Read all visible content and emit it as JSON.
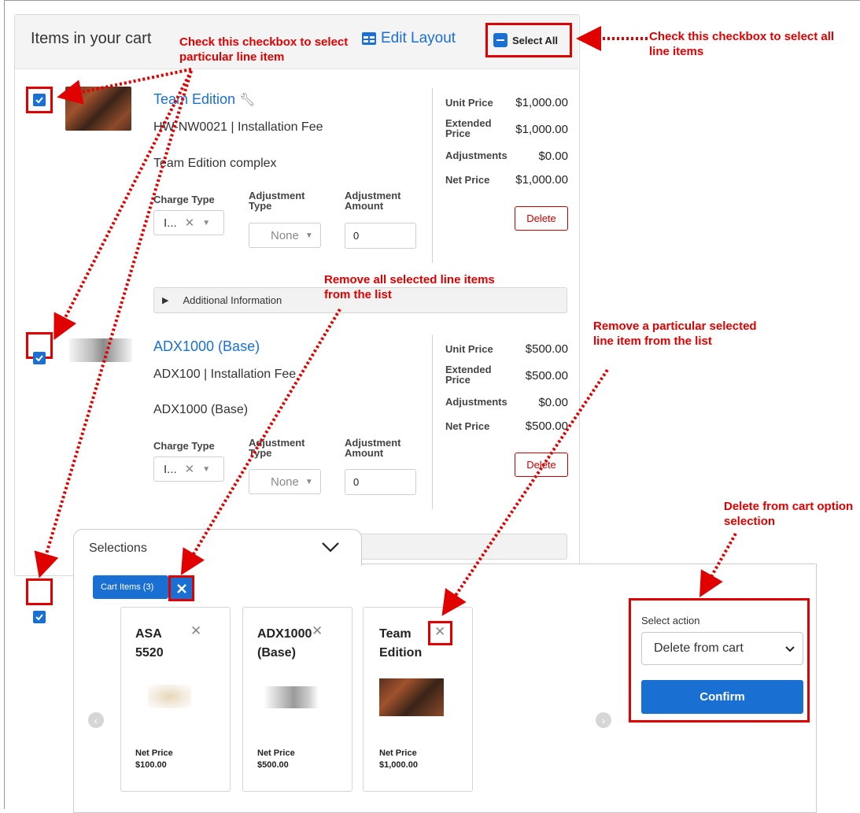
{
  "cart": {
    "title": "Items in your cart",
    "edit_layout": "Edit Layout",
    "select_all": "Select All"
  },
  "line_items": [
    {
      "name": "Team Edition",
      "meta": "HW-NW0021 | Installation Fee",
      "description": "Team Edition complex",
      "charge_type_label": "Charge Type",
      "charge_type_value": "I...",
      "adjustment_type_label": "Adjustment Type",
      "adjustment_type_value": "None",
      "adjustment_amount_label": "Adjustment Amount",
      "adjustment_amount_value": "0",
      "unit_price_label": "Unit Price",
      "unit_price": "$1,000.00",
      "extended_price_label": "Extended Price",
      "extended_price": "$1,000.00",
      "adjustments_label": "Adjustments",
      "adjustments": "$0.00",
      "net_price_label": "Net Price",
      "net_price": "$1,000.00",
      "delete_label": "Delete",
      "additional_info": "Additional Information"
    },
    {
      "name": "ADX1000 (Base)",
      "meta": "ADX100 | Installation Fee",
      "description": "ADX1000 (Base)",
      "charge_type_label": "Charge Type",
      "charge_type_value": "I...",
      "adjustment_type_label": "Adjustment Type",
      "adjustment_type_value": "None",
      "adjustment_amount_label": "Adjustment Amount",
      "adjustment_amount_value": "0",
      "unit_price_label": "Unit Price",
      "unit_price": "$500.00",
      "extended_price_label": "Extended Price",
      "extended_price": "$500.00",
      "adjustments_label": "Adjustments",
      "adjustments": "$0.00",
      "net_price_label": "Net Price",
      "net_price": "$500.00",
      "delete_label": "Delete"
    }
  ],
  "selections": {
    "title": "Selections",
    "chip": "Cart Items (3)",
    "cards": [
      {
        "title": "ASA 5520",
        "np_label": "Net Price",
        "np_value": "$100.00"
      },
      {
        "title": "ADX1000 (Base)",
        "np_label": "Net Price",
        "np_value": "$500.00"
      },
      {
        "title": "Team Edition",
        "np_label": "Net Price",
        "np_value": "$1,000.00"
      }
    ],
    "action_label": "Select action",
    "action_value": "Delete from cart",
    "confirm": "Confirm"
  },
  "annotations": {
    "check_particular": "Check this checkbox to select particular line item",
    "check_all": "Check this checkbox to select all line items",
    "remove_all": "Remove all selected line items from the list",
    "remove_particular": "Remove a particular selected line item from the list",
    "delete_option": "Delete from cart option selection"
  },
  "colors": {
    "accent": "#1a6fd3",
    "annotation": "#e00000",
    "delete": "#cc0000"
  }
}
